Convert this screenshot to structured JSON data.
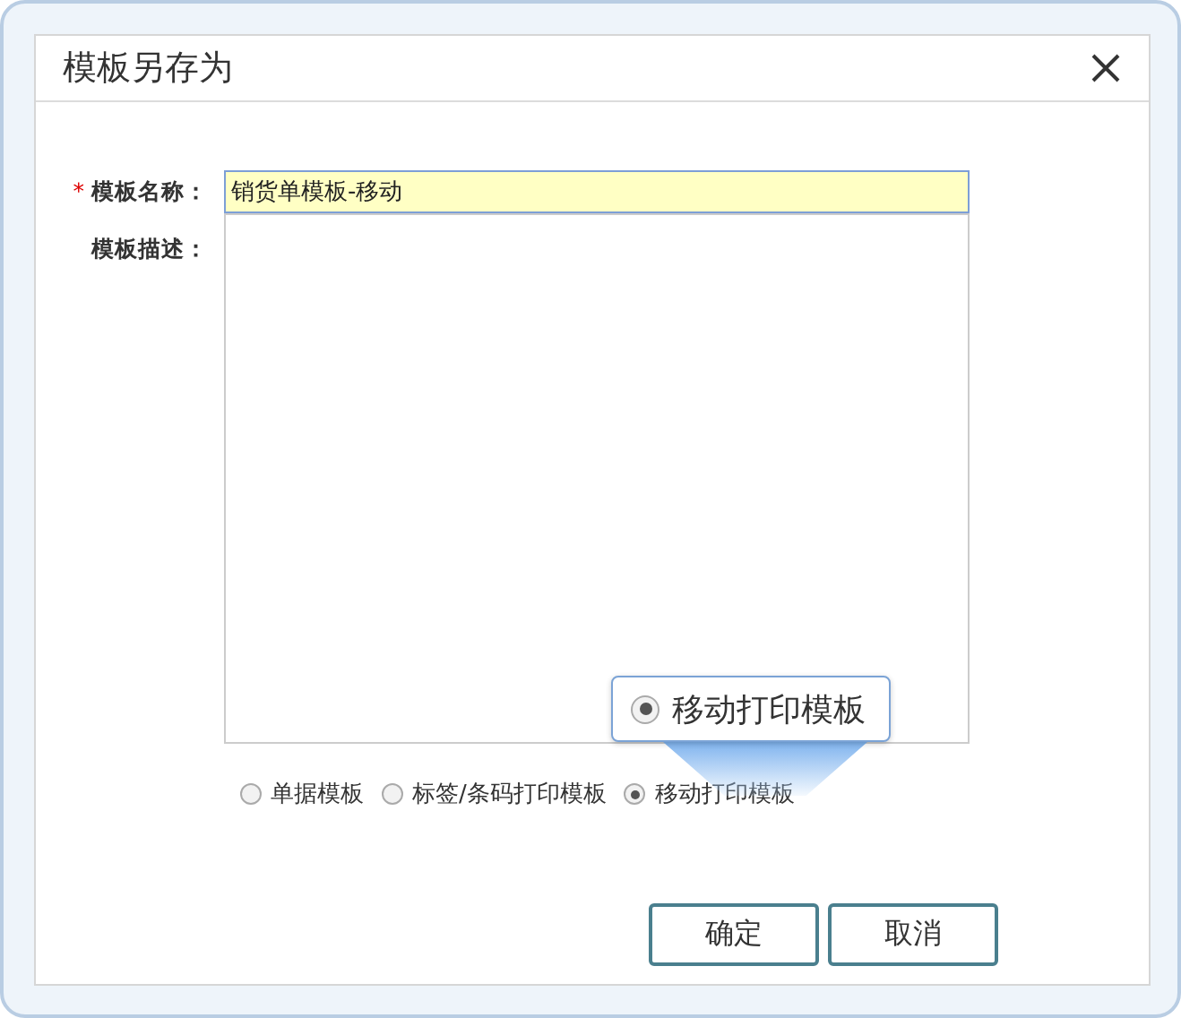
{
  "window": {
    "title": "模板另存为"
  },
  "form": {
    "name": {
      "required_mark": "*",
      "label": "模板名称：",
      "value": "销货单模板-移动"
    },
    "description": {
      "label": "模板描述："
    }
  },
  "template_types": [
    {
      "label": "单据模板",
      "selected": false
    },
    {
      "label": "标签/条码打印模板",
      "selected": false
    },
    {
      "label": "移动打印模板",
      "selected": true
    }
  ],
  "callout": {
    "label": "移动打印模板",
    "selected": true
  },
  "buttons": [
    {
      "label": "确定"
    },
    {
      "label": "取消"
    }
  ]
}
